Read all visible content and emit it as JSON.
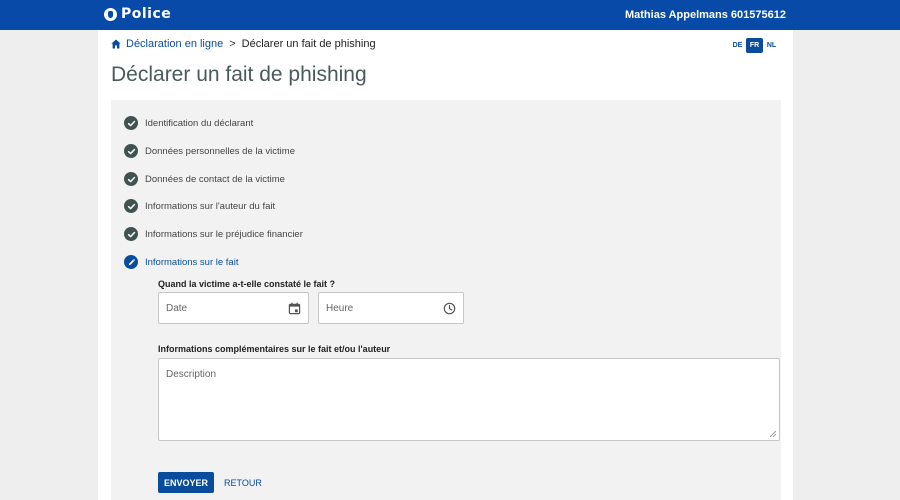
{
  "header": {
    "logo_text": "Police",
    "user_label": "Mathias Appelmans 601575612"
  },
  "breadcrumb": {
    "home_link": "Déclaration en ligne",
    "separator": ">",
    "current": "Déclarer un fait de phishing"
  },
  "languages": [
    {
      "code": "DE",
      "active": false
    },
    {
      "code": "FR",
      "active": true
    },
    {
      "code": "NL",
      "active": false
    }
  ],
  "page_title": "Déclarer un fait de phishing",
  "steps": [
    {
      "label": "Identification du déclarant",
      "status": "completed"
    },
    {
      "label": "Données personnelles de la victime",
      "status": "completed"
    },
    {
      "label": "Données de contact de la victime",
      "status": "completed"
    },
    {
      "label": "Informations sur l'auteur du fait",
      "status": "completed"
    },
    {
      "label": "Informations sur le préjudice financier",
      "status": "completed"
    },
    {
      "label": "Informations sur le fait",
      "status": "current"
    }
  ],
  "form": {
    "when_label": "Quand la victime a-t-elle constaté le fait ?",
    "date_placeholder": "Date",
    "time_placeholder": "Heure",
    "info_label": "Informations complémentaires sur le fait et/ou l'auteur",
    "description_placeholder": "Description"
  },
  "buttons": {
    "submit": "ENVOYER",
    "back": "RETOUR"
  },
  "colors": {
    "header_blue": "#074aa8",
    "accent_blue": "#0a4c9c",
    "completed_step": "#3f5451"
  }
}
